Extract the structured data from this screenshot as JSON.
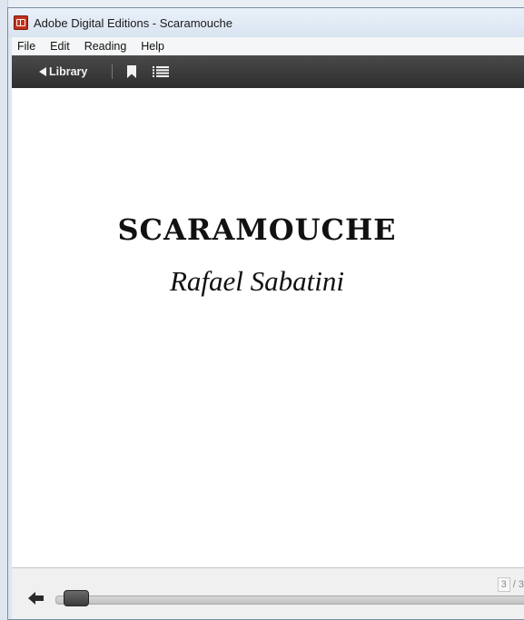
{
  "window": {
    "title": "Adobe Digital Editions - Scaramouche"
  },
  "menu": {
    "items": [
      "File",
      "Edit",
      "Reading",
      "Help"
    ]
  },
  "toolbar": {
    "library_label": "Library"
  },
  "book": {
    "title": "SCARAMOUCHE",
    "author": "Rafael Sabatini"
  },
  "status": {
    "current_page": "3",
    "separator": "/ 3"
  },
  "icons": {
    "app": "adobe-digital-editions-icon",
    "back": "back-arrow-icon",
    "bookmark": "bookmark-icon",
    "toc": "table-of-contents-icon"
  },
  "progress": {
    "fraction": 0.0
  },
  "colors": {
    "toolbar": "#3a3a3a",
    "page": "#ffffff",
    "app_icon": "#c0321f"
  }
}
